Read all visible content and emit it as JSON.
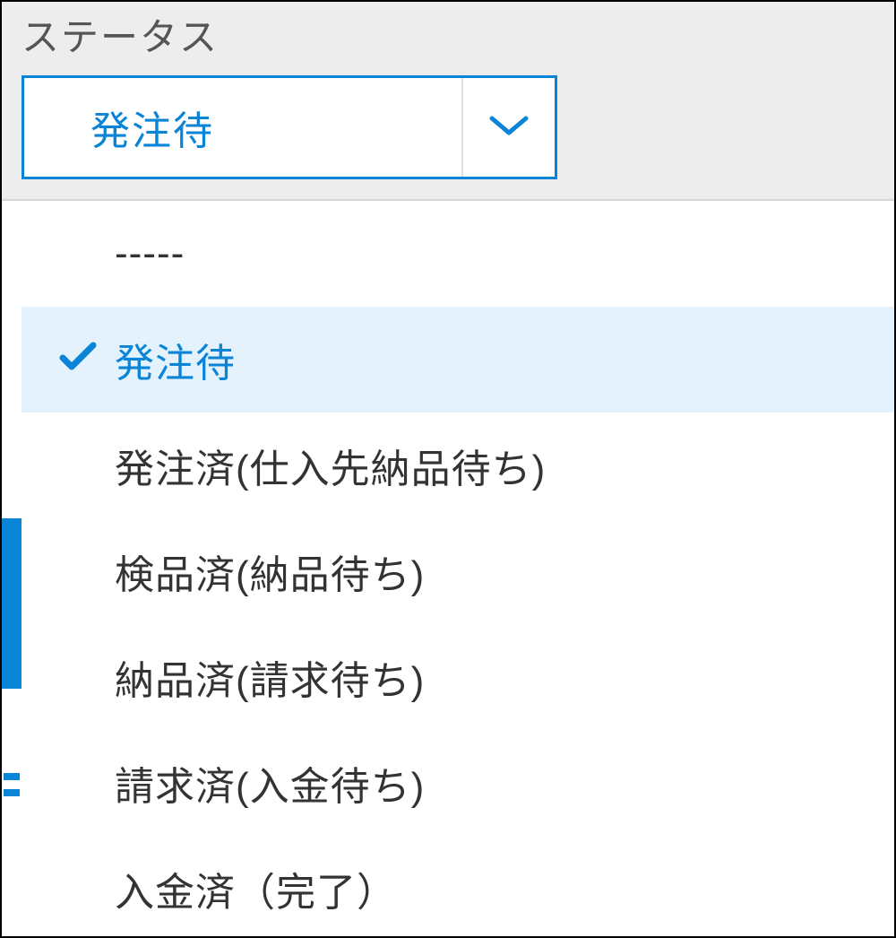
{
  "colors": {
    "accent": "#0a84d6",
    "header_bg": "#ededed",
    "selected_bg": "#e3f2fd",
    "text": "#333333",
    "label": "#555555"
  },
  "status": {
    "label": "ステータス",
    "selected": "発注待",
    "selected_index": 1,
    "options": [
      "-----",
      "発注待",
      "発注済(仕入先納品待ち)",
      "検品済(納品待ち)",
      "納品済(請求待ち)",
      "請求済(入金待ち)",
      "入金済（完了）"
    ]
  }
}
